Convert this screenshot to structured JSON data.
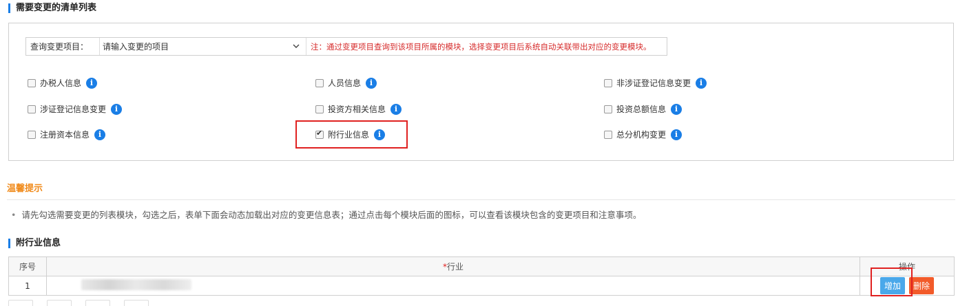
{
  "section_list": {
    "title": "需要变更的清单列表"
  },
  "query": {
    "label": "查询变更项目：",
    "select_value": "请输入变更的项目",
    "note": "注：通过变更项目查询到该项目所属的模块，选择变更项目后系统自动关联带出对应的变更模块。"
  },
  "checkboxes": [
    {
      "label": "办税人信息",
      "checked": false
    },
    {
      "label": "人员信息",
      "checked": false
    },
    {
      "label": "非涉证登记信息变更",
      "checked": false
    },
    {
      "label": "涉证登记信息变更",
      "checked": false
    },
    {
      "label": "投资方相关信息",
      "checked": false
    },
    {
      "label": "投资总额信息",
      "checked": false
    },
    {
      "label": "注册资本信息",
      "checked": false
    },
    {
      "label": "附行业信息",
      "checked": true
    },
    {
      "label": "总分机构变更",
      "checked": false
    }
  ],
  "info_icon_glyph": "i",
  "tips": {
    "title": "温馨提示",
    "text": "请先勾选需要变更的列表模块，勾选之后，表单下面会动态加载出对应的变更信息表；通过点击每个模块后面的图标，可以查看该模块包含的变更项目和注意事项。"
  },
  "section_industry": {
    "title": "附行业信息"
  },
  "table": {
    "headers": {
      "seq": "序号",
      "required_mark": "*",
      "industry": "行业",
      "ops": "操作"
    },
    "rows": [
      {
        "seq": "1"
      }
    ],
    "add_label": "增加",
    "delete_label": "删除"
  },
  "colors": {
    "accent": "#1a7ee6",
    "warning_text": "#d62b2b",
    "highlight": "#e0201f",
    "tips_title": "#f08a1a"
  }
}
